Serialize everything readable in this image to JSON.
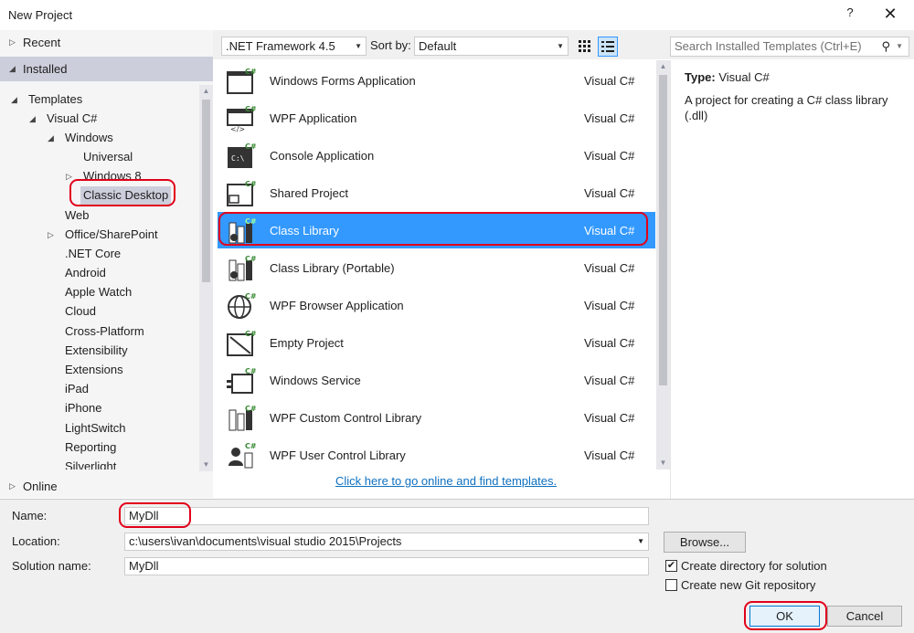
{
  "window": {
    "title": "New Project",
    "help": "?",
    "close": "✕"
  },
  "left": {
    "recent": "Recent",
    "installed": "Installed",
    "online": "Online",
    "tree": [
      {
        "label": "Templates",
        "expander": "◢"
      },
      {
        "label": "Visual C#",
        "expander": "◢"
      },
      {
        "label": "Windows",
        "expander": "◢"
      },
      {
        "label": "Universal",
        "expander": ""
      },
      {
        "label": "Windows 8",
        "expander": "▷"
      },
      {
        "label": "Classic Desktop",
        "expander": ""
      },
      {
        "label": "Web",
        "expander": ""
      },
      {
        "label": "Office/SharePoint",
        "expander": "▷"
      },
      {
        "label": ".NET Core",
        "expander": ""
      },
      {
        "label": "Android",
        "expander": ""
      },
      {
        "label": "Apple Watch",
        "expander": ""
      },
      {
        "label": "Cloud",
        "expander": ""
      },
      {
        "label": "Cross-Platform",
        "expander": ""
      },
      {
        "label": "Extensibility",
        "expander": ""
      },
      {
        "label": "Extensions",
        "expander": ""
      },
      {
        "label": "iPad",
        "expander": ""
      },
      {
        "label": "iPhone",
        "expander": ""
      },
      {
        "label": "LightSwitch",
        "expander": ""
      },
      {
        "label": "Reporting",
        "expander": ""
      },
      {
        "label": "Silverlight",
        "expander": ""
      }
    ]
  },
  "toolbar": {
    "framework": ".NET Framework 4.5",
    "sort_label": "Sort by:",
    "sort_value": "Default",
    "search_placeholder": "Search Installed Templates (Ctrl+E)"
  },
  "templates": [
    {
      "name": "Windows Forms Application",
      "lang": "Visual C#",
      "icon": "windows-forms-icon"
    },
    {
      "name": "WPF Application",
      "lang": "Visual C#",
      "icon": "wpf-application-icon"
    },
    {
      "name": "Console Application",
      "lang": "Visual C#",
      "icon": "console-application-icon"
    },
    {
      "name": "Shared Project",
      "lang": "Visual C#",
      "icon": "shared-project-icon"
    },
    {
      "name": "Class Library",
      "lang": "Visual C#",
      "icon": "class-library-icon"
    },
    {
      "name": "Class Library (Portable)",
      "lang": "Visual C#",
      "icon": "class-library-portable-icon"
    },
    {
      "name": "WPF Browser Application",
      "lang": "Visual C#",
      "icon": "wpf-browser-icon"
    },
    {
      "name": "Empty Project",
      "lang": "Visual C#",
      "icon": "empty-project-icon"
    },
    {
      "name": "Windows Service",
      "lang": "Visual C#",
      "icon": "windows-service-icon"
    },
    {
      "name": "WPF Custom Control Library",
      "lang": "Visual C#",
      "icon": "wpf-custom-control-icon"
    },
    {
      "name": "WPF User Control Library",
      "lang": "Visual C#",
      "icon": "wpf-user-control-icon"
    }
  ],
  "online_link": "Click here to go online and find templates.",
  "details": {
    "type_label": "Type:",
    "type_value": "Visual C#",
    "description": "A project for creating a C# class library (.dll)"
  },
  "form": {
    "name_label": "Name:",
    "name_value": "MyDll",
    "location_label": "Location:",
    "location_value": "c:\\users\\ivan\\documents\\visual studio 2015\\Projects",
    "solution_label": "Solution name:",
    "solution_value": "MyDll",
    "browse_label": "Browse...",
    "create_dir_label": "Create directory for solution",
    "create_dir_checked": "✔",
    "git_label": "Create new Git repository",
    "ok_label": "OK",
    "cancel_label": "Cancel"
  },
  "colors": {
    "selection": "#3399ff",
    "highlight_ring": "#e2001a",
    "tree_selected": "#cccedb"
  }
}
